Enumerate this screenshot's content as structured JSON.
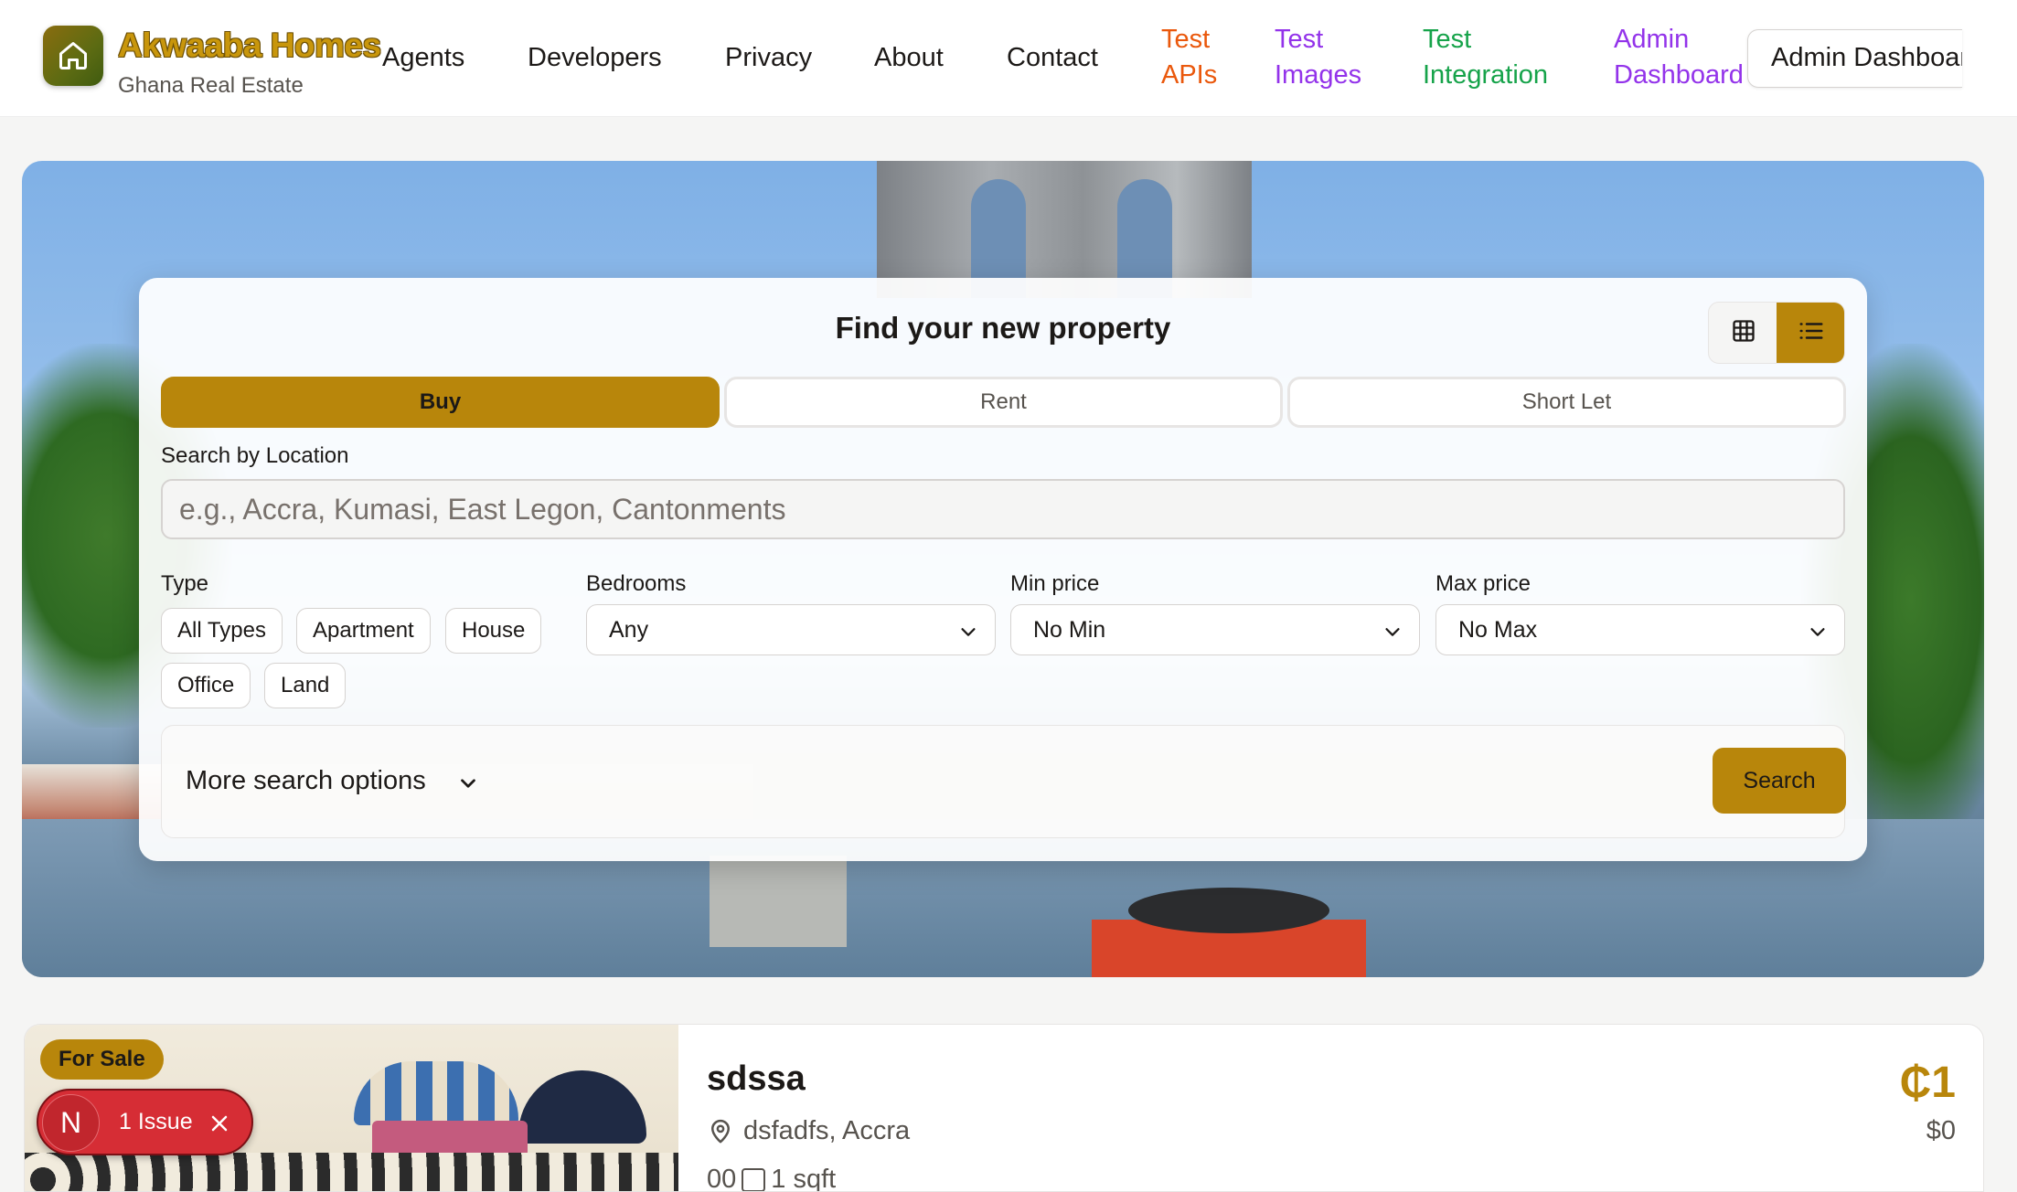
{
  "brand": {
    "name": "Akwaaba Homes",
    "subtitle": "Ghana Real Estate",
    "logo_icon": "house-icon"
  },
  "nav": {
    "agents": "Agents",
    "developers": "Developers",
    "privacy": "Privacy",
    "about": "About",
    "contact": "Contact",
    "test_apis": "Test APIs",
    "test_images": "Test Images",
    "test_integration": "Test Integration",
    "admin_dashboard_link": "Admin Dashboard",
    "admin_dashboard_button": "Admin Dashboard",
    "colors": {
      "test_apis": "#ea580c",
      "test_images": "#9333ea",
      "test_integration": "#16a34a",
      "admin_dashboard_link": "#9333ea"
    }
  },
  "search": {
    "title": "Find your new property",
    "view_toggle": {
      "grid_icon": "grid-icon",
      "list_icon": "list-icon",
      "active": "list"
    },
    "tabs": [
      {
        "label": "Buy",
        "active": true
      },
      {
        "label": "Rent",
        "active": false
      },
      {
        "label": "Short Let",
        "active": false
      }
    ],
    "location_label": "Search by Location",
    "location_placeholder": "e.g., Accra, Kumasi, East Legon, Cantonments",
    "location_value": "",
    "type_label": "Type",
    "types": [
      "All Types",
      "Apartment",
      "House",
      "Office",
      "Land"
    ],
    "bedrooms_label": "Bedrooms",
    "bedrooms_value": "Any",
    "min_price_label": "Min price",
    "min_price_value": "No Min",
    "max_price_label": "Max price",
    "max_price_value": "No Max",
    "more_options": "More search options",
    "search_button": "Search",
    "accent_color": "#b8860b"
  },
  "listing": {
    "badge": "For Sale",
    "title": "sdssa",
    "location": "dsfadfs, Accra",
    "bedrooms_baths": "00",
    "area": "1 sqft",
    "price": "₵1",
    "price_usd": "$0"
  },
  "dev_overlay": {
    "letter": "N",
    "label": "1 Issue"
  }
}
